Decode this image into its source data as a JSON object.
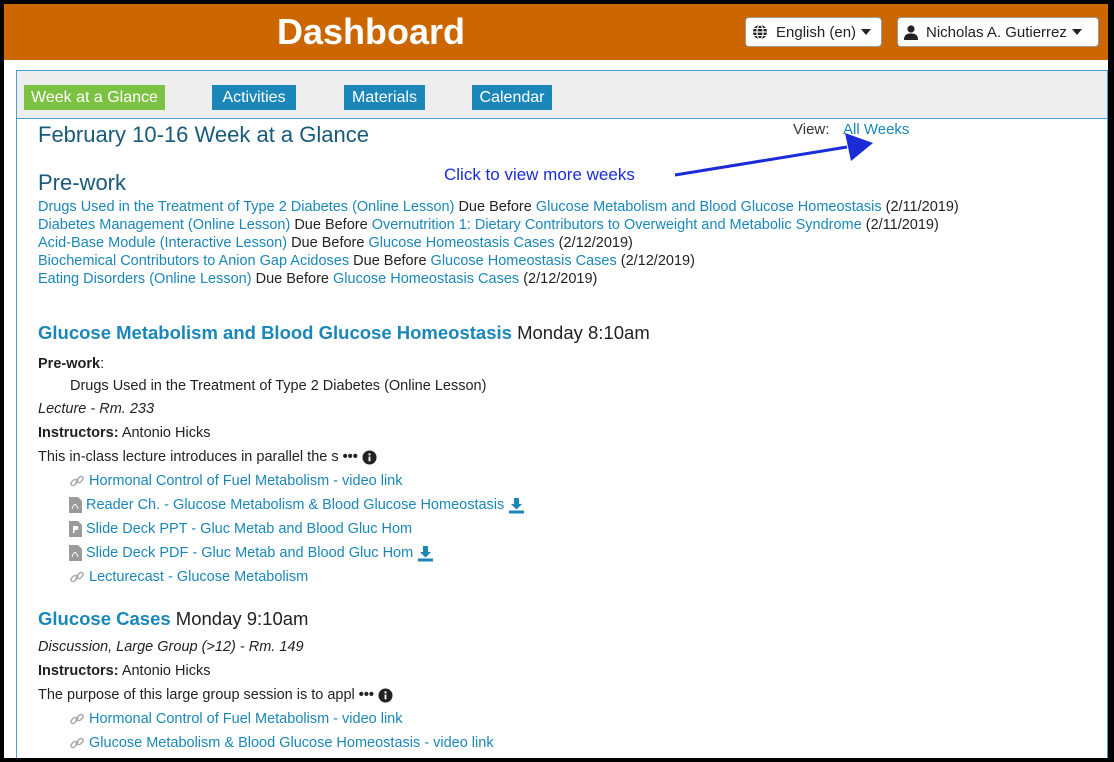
{
  "header": {
    "title": "Dashboard",
    "language_label": "English (en)",
    "user_label": "Nicholas A. Gutierrez",
    "bg_color": "#cc6600"
  },
  "tabs": [
    {
      "label": "Week at a Glance",
      "active": true
    },
    {
      "label": "Activities",
      "active": false
    },
    {
      "label": "Materials",
      "active": false
    },
    {
      "label": "Calendar",
      "active": false
    }
  ],
  "week": {
    "title": "February 10-16 Week at a Glance",
    "view_label": "View:",
    "view_link": "All Weeks",
    "callout": "Click to view more weeks"
  },
  "prework": {
    "heading": "Pre-work",
    "items": [
      {
        "item": "Drugs Used in the Treatment of Type 2 Diabetes (Online Lesson)",
        "due": "Due Before",
        "session": "Glucose Metabolism and Blood Glucose Homeostasis",
        "date": "(2/11/2019)"
      },
      {
        "item": "Diabetes Management (Online Lesson)",
        "due": "Due Before",
        "session": "Overnutrition 1: Dietary Contributors to Overweight and Metabolic Syndrome",
        "date": "(2/11/2019)"
      },
      {
        "item": "Acid-Base Module (Interactive Lesson)",
        "due": "Due Before",
        "session": "Glucose Homeostasis Cases",
        "date": "(2/12/2019)"
      },
      {
        "item": "Biochemical Contributors to Anion Gap Acidoses",
        "due": "Due Before",
        "session": "Glucose Homeostasis Cases",
        "date": "(2/12/2019)"
      },
      {
        "item": "Eating Disorders (Online Lesson)",
        "due": "Due Before",
        "session": "Glucose Homeostasis Cases",
        "date": "(2/12/2019)"
      }
    ]
  },
  "session1": {
    "title": "Glucose Metabolism and Blood Glucose Homeostasis",
    "when": "Monday 8:10am",
    "prework_label": "Pre-work",
    "prework_colon": ":",
    "prework_item": "Drugs Used in the Treatment of Type 2 Diabetes (Online Lesson)",
    "type": "Lecture - Rm. 233",
    "instructors_label": "Instructors:",
    "instructors": "Antonio Hicks",
    "desc": "This in-class lecture introduces in parallel the s",
    "ellipsis": "•••",
    "resources": [
      {
        "icon": "link-icon",
        "label": "Hormonal Control of Fuel Metabolism - video link"
      },
      {
        "icon": "pdf-icon",
        "label": "Reader Ch. - Glucose Metabolism & Blood Glucose Homeostasis",
        "download": true
      },
      {
        "icon": "ppt-icon",
        "label": "Slide Deck PPT - Gluc Metab and Blood Gluc Hom"
      },
      {
        "icon": "pdf-icon",
        "label": "Slide Deck PDF - Gluc Metab and Blood Gluc Hom",
        "download": true
      },
      {
        "icon": "link-icon",
        "label": "Lecturecast - Glucose Metabolism"
      }
    ]
  },
  "session2": {
    "title": "Glucose Cases",
    "when": "Monday 9:10am",
    "type": "Discussion, Large Group (>12) - Rm. 149",
    "instructors_label": "Instructors:",
    "instructors": "Antonio Hicks",
    "desc": "The purpose of this large group session is to appl",
    "ellipsis": "•••",
    "resources": [
      {
        "icon": "link-icon",
        "label": "Hormonal Control of Fuel Metabolism - video link"
      },
      {
        "icon": "link-icon",
        "label": "Glucose Metabolism & Blood Glucose Homeostasis - video link"
      }
    ]
  },
  "colors": {
    "link": "#1a87b8",
    "tab_active": "#7cc242",
    "tab": "#1a87b8",
    "callout": "#1a2bd8"
  }
}
